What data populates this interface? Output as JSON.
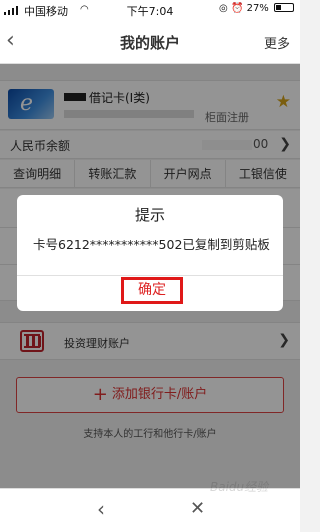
{
  "status": {
    "carrier": "中国移动",
    "wifi_icon": "wifi-icon",
    "time": "下午7:04",
    "battery": "27%",
    "battery_level": 0.27
  },
  "nav": {
    "back_icon": "chevron-left-icon",
    "title": "我的账户",
    "more": "更多"
  },
  "card": {
    "name": "借记卡(I类)",
    "counter_tag": "柜面注册",
    "star_icon": "star-icon"
  },
  "balance": {
    "label": "人民币余额",
    "value": "00"
  },
  "actions": [
    "查询明细",
    "转账汇款",
    "开户网点",
    "工银信使"
  ],
  "wealth": {
    "label": "投资理财账户"
  },
  "add_card": {
    "label": "添加银行卡/账户",
    "support": "支持本人的工行和他行卡/账户"
  },
  "dialog": {
    "title": "提示",
    "message": "卡号6212***********502已复制到剪贴板",
    "confirm": "确定"
  },
  "bottom": {
    "back_icon": "chevron-left-icon",
    "close_icon": "close-icon"
  },
  "watermark": "Baidu经验",
  "colors": {
    "accent_red": "#d33333",
    "highlight_red": "#e01818",
    "star_gold": "#d4a21b"
  }
}
